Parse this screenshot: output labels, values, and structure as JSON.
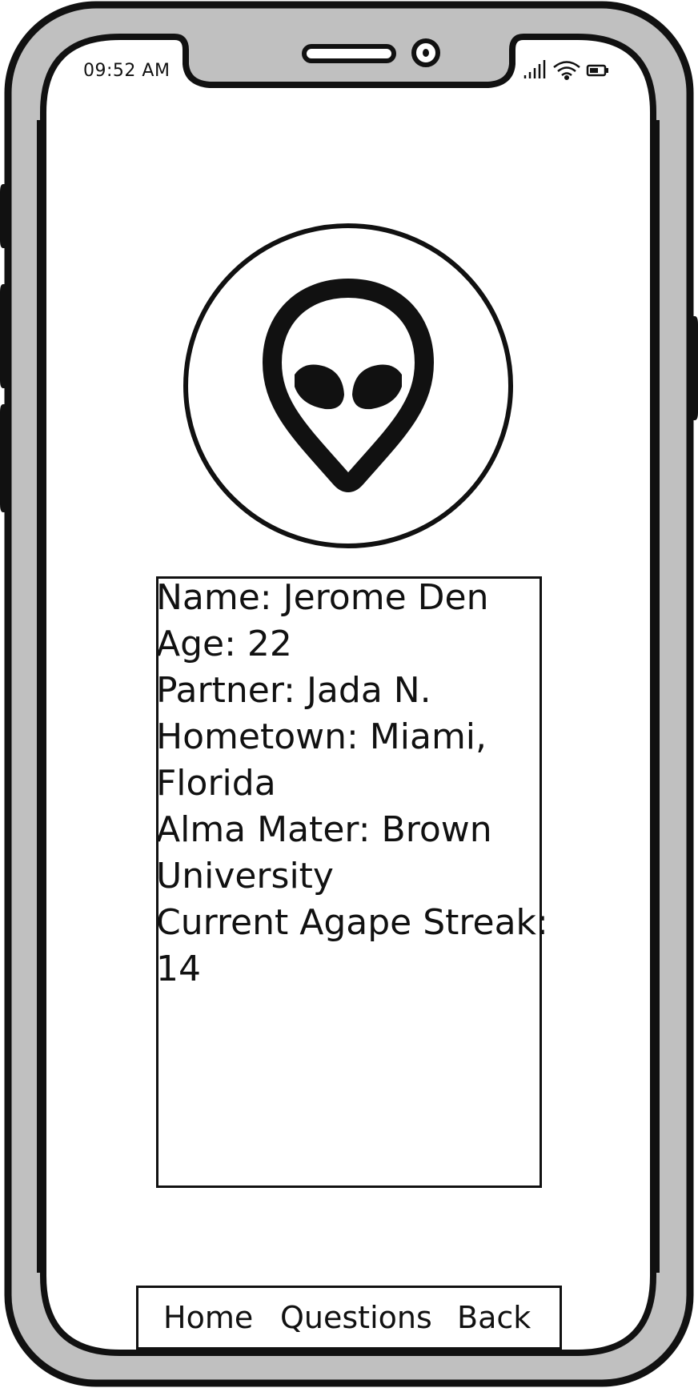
{
  "status_bar": {
    "time": "09:52 AM",
    "icons": [
      "signal-icon",
      "wifi-icon",
      "battery-icon"
    ]
  },
  "profile": {
    "avatar_icon": "alien-icon",
    "lines": [
      "Name: Jerome Den",
      "Age:  22",
      "Partner: Jada N.",
      "Hometown: Miami,",
      "Florida",
      "Alma Mater: Brown",
      "University",
      "Current Agape Streak:",
      "14"
    ]
  },
  "nav": {
    "home": "Home",
    "questions": "Questions",
    "back": "Back"
  },
  "colors": {
    "frame": "#c0c0c0",
    "stroke": "#111111",
    "screen": "#ffffff"
  }
}
